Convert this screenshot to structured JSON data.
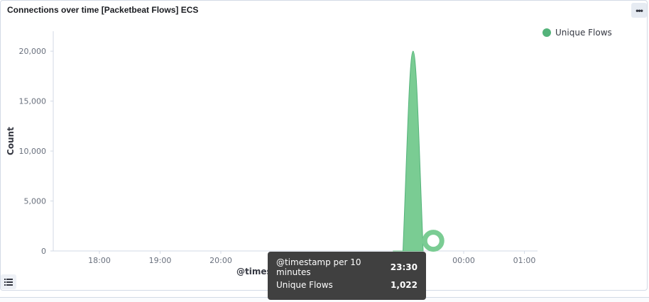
{
  "panel": {
    "title": "Connections over time [Packetbeat Flows] ECS",
    "menu_icon": "ellipsis-icon",
    "legend_toggle_icon": "list-icon"
  },
  "chart_data": {
    "type": "area",
    "title": "",
    "xlabel": "@timestamp per 10 minutes",
    "ylabel": "Count",
    "x_ticks": [
      "18:00",
      "19:00",
      "20:00",
      "00:00",
      "01:00"
    ],
    "y_ticks": [
      "0",
      "5,000",
      "10,000",
      "15,000",
      "20,000"
    ],
    "ylim": [
      0,
      22000
    ],
    "series": [
      {
        "name": "Unique Flows",
        "color": "#54b37a",
        "x": [
          "22:50",
          "23:00",
          "23:10",
          "23:20",
          "23:30"
        ],
        "values": [
          0,
          0,
          20000,
          0,
          1022
        ]
      }
    ],
    "legend_position": "top-right",
    "grid": false
  },
  "tooltip": {
    "rows": [
      {
        "label": "@timestamp per 10 minutes",
        "value": "23:30"
      },
      {
        "label": "Unique Flows",
        "value": "1,022"
      }
    ]
  },
  "axis_title_visible": "@times"
}
